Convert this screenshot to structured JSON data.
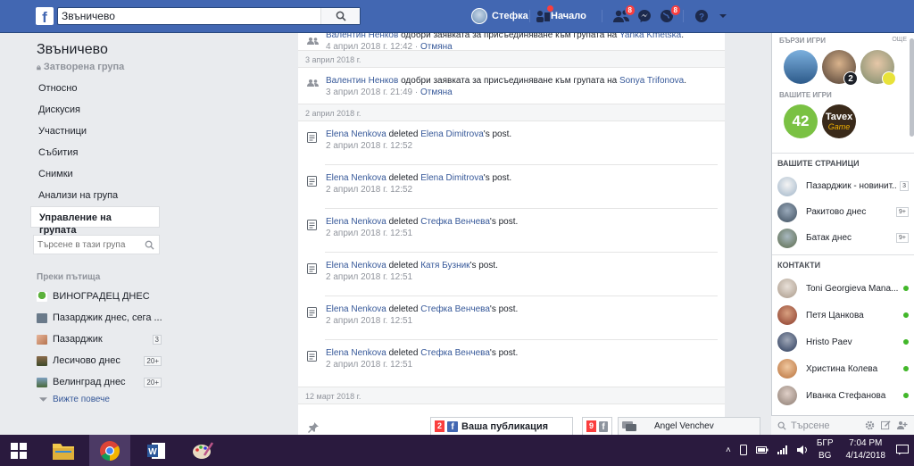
{
  "topbar": {
    "search_value": "Звъничево",
    "user_name": "Стефка",
    "home_label": "Начало",
    "friend_requests_count": "8",
    "notifications_count": "8"
  },
  "left": {
    "group_name": "Звъничево",
    "group_type": "Затворена група",
    "nav": [
      "Относно",
      "Дискусия",
      "Участници",
      "Събития",
      "Снимки",
      "Анализи на група",
      "Управление на групата"
    ],
    "search_placeholder": "Търсене в тази група",
    "shortcuts_title": "Преки пътища",
    "shortcuts": [
      {
        "label": "ВИНОГРАДЕЦ ДНЕС",
        "count": ""
      },
      {
        "label": "Пазарджик днес, сега ...",
        "count": ""
      },
      {
        "label": "Пазарджик",
        "count": "3"
      },
      {
        "label": "Лесичово днес",
        "count": "20+"
      },
      {
        "label": "Велинград днес",
        "count": "20+"
      }
    ],
    "see_more": "Вижте повече"
  },
  "feed": {
    "entry0": {
      "actor": "Валентин Ненков",
      "action": " одобри заявката за присъединяване към групата на ",
      "target": "Yanka Kmetska",
      "end": ".",
      "time": "4 април 2018 г. 12:42",
      "undo": "Отмяна"
    },
    "date1": "3 април 2018 г.",
    "entry1": {
      "actor": "Валентин Ненков",
      "action": " одобри заявката за присъединяване към групата на ",
      "target": "Sonya Trifonova",
      "end": ".",
      "time": "3 април 2018 г. 21:49",
      "undo": "Отмяна"
    },
    "date2": "2 април 2018 г.",
    "deletions": [
      {
        "actor": "Elena Nenkova",
        "verb": " deleted ",
        "target": "Elena Dimitrova",
        "end": "'s post.",
        "time": "2 април 2018 г. 12:52"
      },
      {
        "actor": "Elena Nenkova",
        "verb": " deleted ",
        "target": "Elena Dimitrova",
        "end": "'s post.",
        "time": "2 април 2018 г. 12:52"
      },
      {
        "actor": "Elena Nenkova",
        "verb": " deleted ",
        "target": "Стефка Венчева",
        "end": "'s post.",
        "time": "2 април 2018 г. 12:51"
      },
      {
        "actor": "Elena Nenkova",
        "verb": " deleted ",
        "target": "Катя Бузник",
        "end": "'s post.",
        "time": "2 април 2018 г. 12:51"
      },
      {
        "actor": "Elena Nenkova",
        "verb": " deleted ",
        "target": "Стефка Венчева",
        "end": "'s post.",
        "time": "2 април 2018 г. 12:51"
      },
      {
        "actor": "Elena Nenkova",
        "verb": " deleted ",
        "target": "Стефка Венчева",
        "end": "'s post.",
        "time": "2 април 2018 г. 12:51"
      }
    ],
    "date3": "12 март 2018 г."
  },
  "bottom_bar": {
    "publication_count": "2",
    "publication_label": "Ваша публикация",
    "fb_count": "9",
    "chat_name": "Angel Venchev"
  },
  "right": {
    "quick_games": "БЪРЗИ ИГРИ",
    "more": "ОЩЕ",
    "your_games": "ВАШИТЕ ИГРИ",
    "game_42": "42",
    "game_tavex": "Tavex",
    "game_tavex_sub": "Game",
    "your_pages": "ВАШИТЕ СТРАНИЦИ",
    "pages": [
      {
        "label": "Пазарджик - новинит...",
        "badge": "3"
      },
      {
        "label": "Ракитово днес",
        "badge": "9+"
      },
      {
        "label": "Батак днес",
        "badge": "9+"
      }
    ],
    "contacts_title": "КОНТАКТИ",
    "contacts": [
      "Toni Georgieva Mana...",
      "Петя Цанкова",
      "Hristo Paev",
      "Христина Колева",
      "Иванка Стефанова"
    ],
    "chat_search": "Търсене"
  },
  "taskbar": {
    "lang1": "БГР",
    "lang2": "BG",
    "time": "7:04 PM",
    "date": "4/14/2018"
  }
}
